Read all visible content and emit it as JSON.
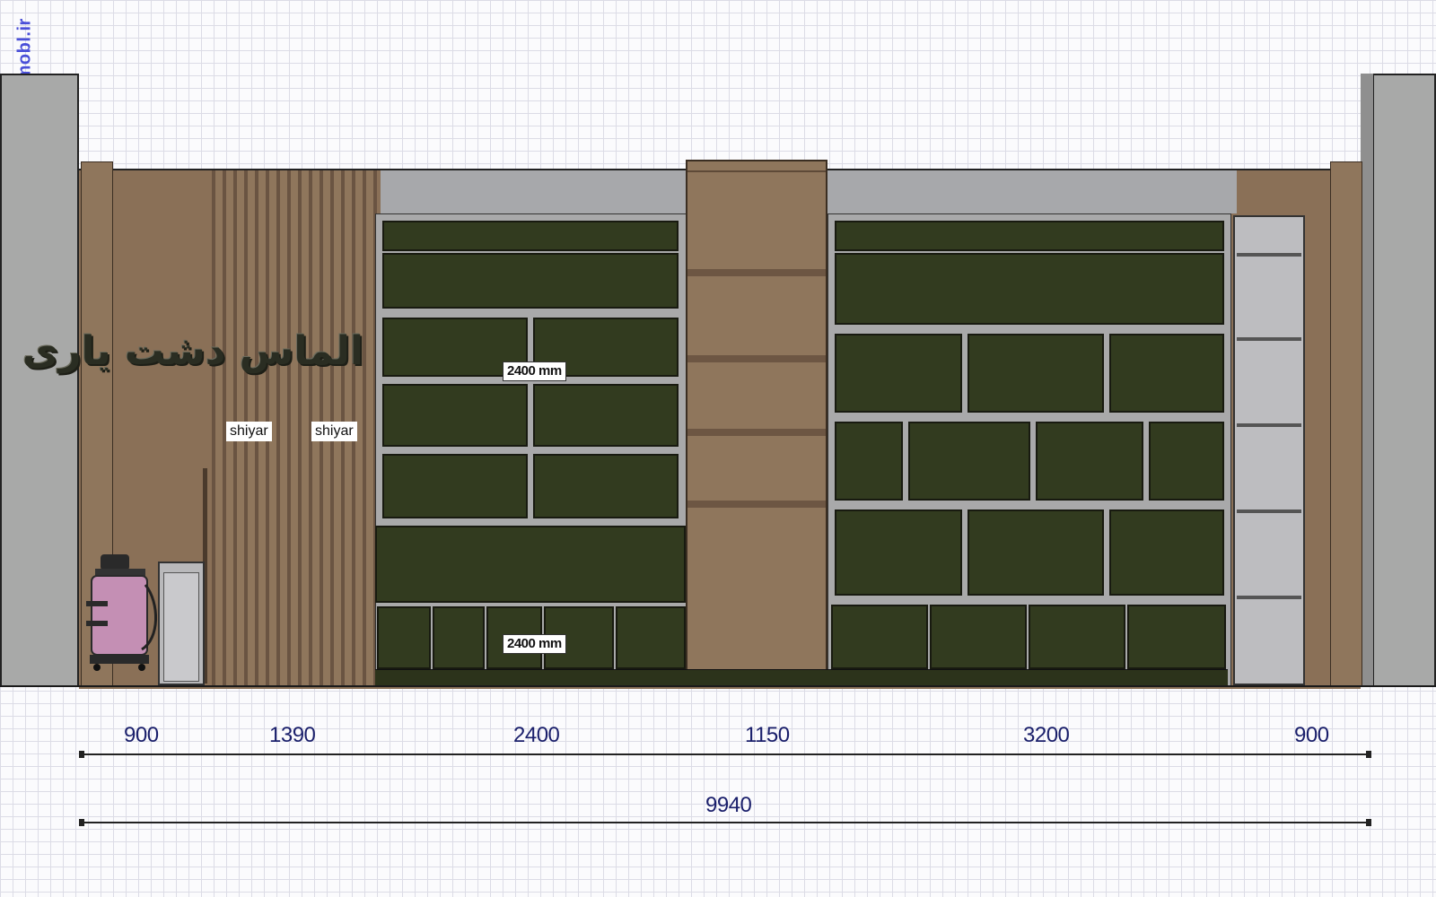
{
  "watermark": "cmobl.ir",
  "sign_text": "الماس دشت یاری",
  "labels": {
    "shiyar_left": "shiyar",
    "shiyar_right": "shiyar",
    "height_upper": "2400 mm",
    "height_lower": "2400 mm"
  },
  "dimensions": {
    "segments": [
      "900",
      "1390",
      "2400",
      "1150",
      "3200",
      "900"
    ],
    "total": "9940"
  },
  "colors": {
    "wall_gray": "#a8a9a8",
    "wood_brown": "#8a7057",
    "dark_olive_panel": "#323b1f",
    "frame_gray": "#a9a9aa",
    "dimension_text": "#1a1f6b",
    "watermark": "#4a4fd8"
  }
}
